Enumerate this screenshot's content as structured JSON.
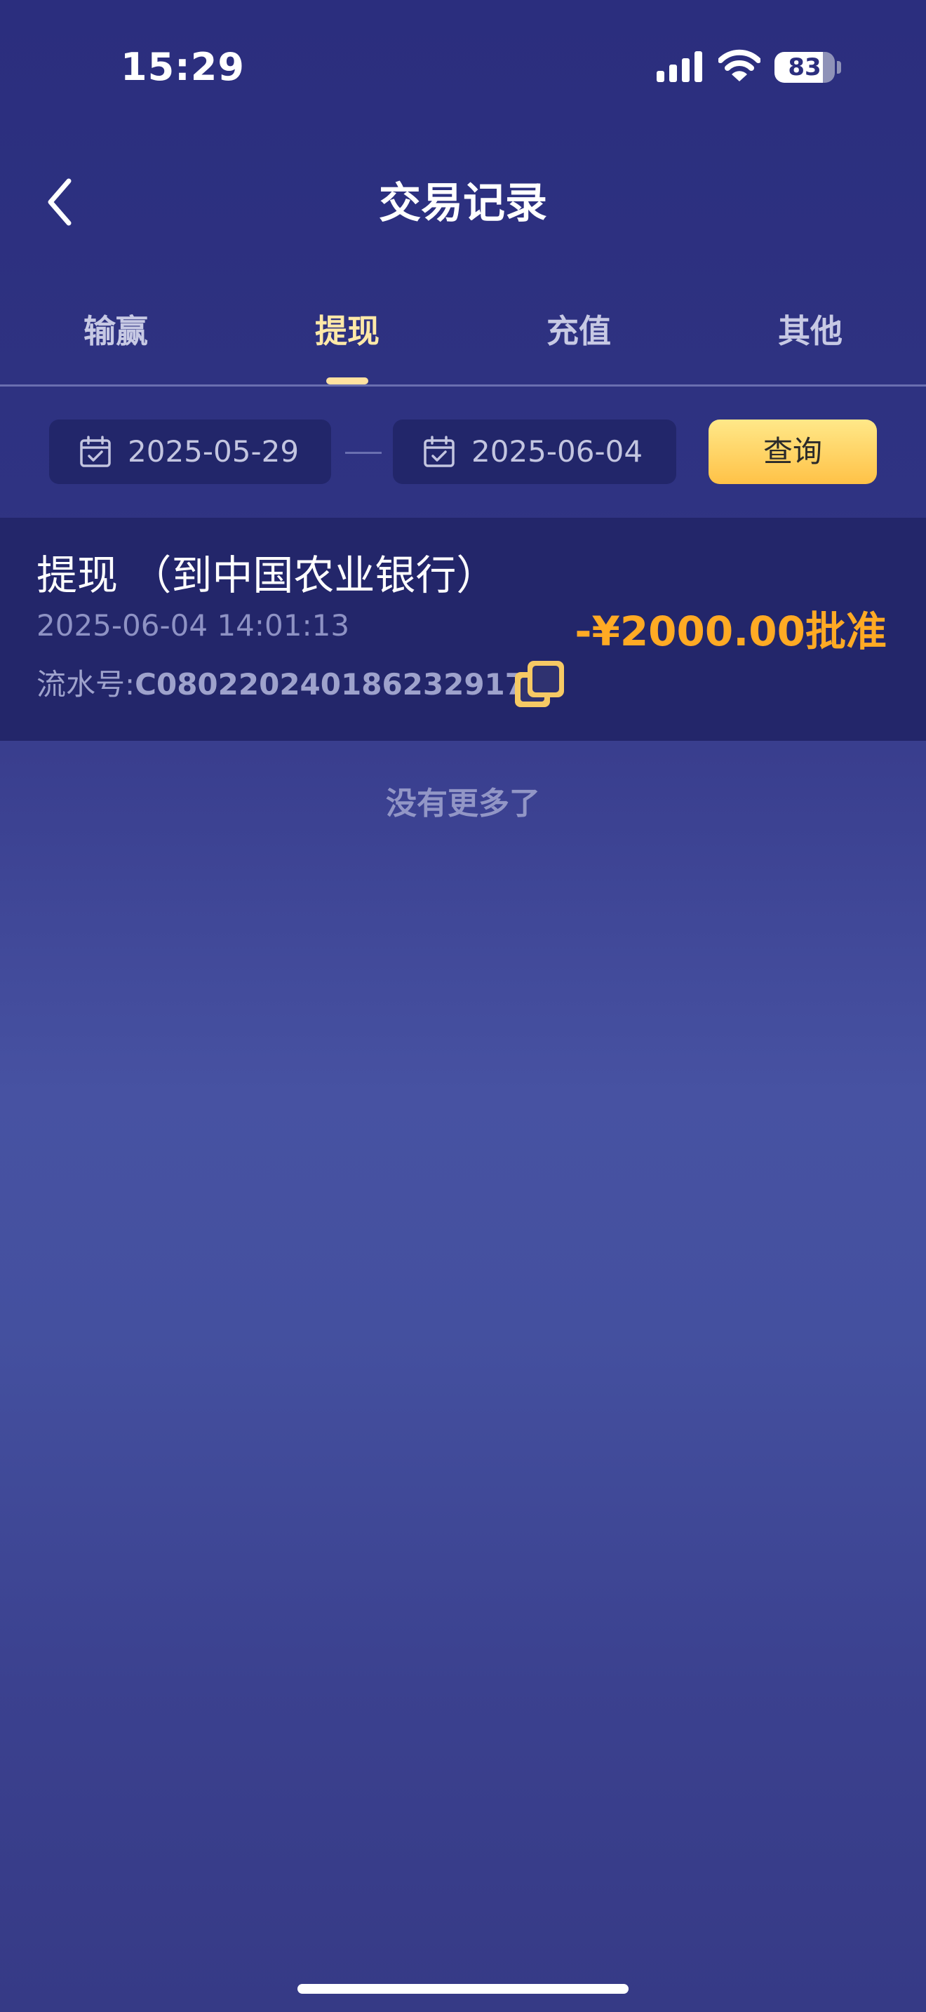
{
  "status_bar": {
    "time": "15:29",
    "battery": "83",
    "icons": [
      "signal-icon",
      "wifi-icon",
      "battery-icon"
    ]
  },
  "header": {
    "title": "交易记录",
    "back_icon": "chevron-left-icon"
  },
  "tabs": [
    {
      "label": "输赢",
      "active": false
    },
    {
      "label": "提现",
      "active": true
    },
    {
      "label": "充值",
      "active": false
    },
    {
      "label": "其他",
      "active": false
    }
  ],
  "filter": {
    "start_date": "2025-05-29",
    "end_date": "2025-06-04",
    "query_label": "查询",
    "date_icon": "calendar-icon"
  },
  "records": [
    {
      "title": "提现 （到中国农业银行）",
      "time": "2025-06-04 14:01:13",
      "serial_label": "流水号:",
      "serial_number": "C08022024018623291​7",
      "amount_status": "-¥2000.00批准",
      "copy_icon": "copy-icon"
    }
  ],
  "footer": {
    "no_more": "没有更多了"
  },
  "colors": {
    "background": "#2b2e7e",
    "accent": "#ffaa24",
    "active_tab": "#ffe9a8",
    "button": "#ffd466"
  }
}
